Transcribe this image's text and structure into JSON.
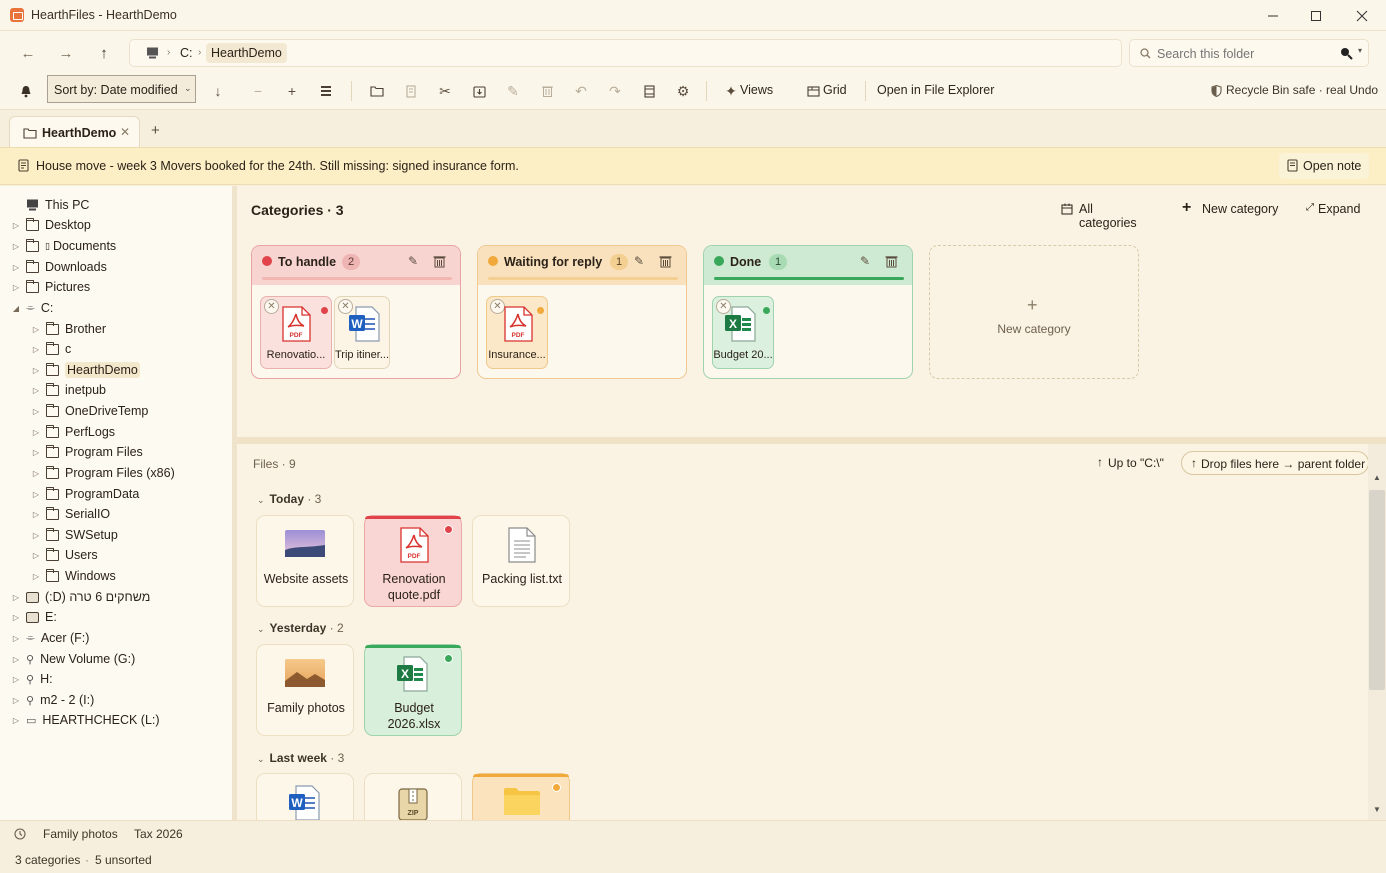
{
  "window": {
    "title": "HearthFiles - HearthDemo"
  },
  "address": {
    "segments": [
      "C:",
      "HearthDemo"
    ]
  },
  "search": {
    "placeholder": "Search this folder"
  },
  "toolbar": {
    "sort_label": "Sort by: Date modified",
    "views_label": "Views",
    "grid_label": "Grid",
    "open_explorer_label": "Open in File Explorer",
    "safety_label": "Recycle Bin safe · real Undo"
  },
  "tabs": [
    {
      "label": "HearthDemo"
    }
  ],
  "note": {
    "text": "House move - week 3 Movers booked for the 24th. Still missing: signed insurance form.",
    "open_label": "Open note"
  },
  "sidebar": {
    "items": [
      {
        "label": "This PC"
      },
      {
        "label": "Desktop"
      },
      {
        "label": "Documents"
      },
      {
        "label": "Downloads"
      },
      {
        "label": "Pictures"
      },
      {
        "label": "C:"
      },
      {
        "label": "Brother"
      },
      {
        "label": "c"
      },
      {
        "label": "HearthDemo"
      },
      {
        "label": "inetpub"
      },
      {
        "label": "OneDriveTemp"
      },
      {
        "label": "PerfLogs"
      },
      {
        "label": "Program Files"
      },
      {
        "label": "Program Files (x86)"
      },
      {
        "label": "ProgramData"
      },
      {
        "label": "SerialIO"
      },
      {
        "label": "SWSetup"
      },
      {
        "label": "Users"
      },
      {
        "label": "Windows"
      },
      {
        "label": "(:D) משחקים 6 טרה"
      },
      {
        "label": "E:"
      },
      {
        "label": "Acer (F:)"
      },
      {
        "label": "New Volume (G:)"
      },
      {
        "label": "H:"
      },
      {
        "label": "m2 - 2 (I:)"
      },
      {
        "label": "HEARTHCHECK (L:)"
      }
    ]
  },
  "categories": {
    "title": "Categories · 3",
    "all_label": "All categories",
    "new_label": "New category",
    "expand_label": "Expand",
    "cards": [
      {
        "name": "To handle",
        "count": "2",
        "color": "#e0434a",
        "items": [
          "Renovatio...",
          "Trip itiner..."
        ]
      },
      {
        "name": "Waiting for reply",
        "count": "1",
        "color": "#f0a93a",
        "items": [
          "Insurance..."
        ]
      },
      {
        "name": "Done",
        "count": "1",
        "color": "#3aa85a",
        "items": [
          "Budget 20..."
        ]
      }
    ],
    "new_card_label": "New category"
  },
  "files": {
    "count_label": "Files · 9",
    "up_label": "Up to \"C:\\\"",
    "drop_label": "Drop files here → parent folder",
    "groups": [
      {
        "name": "Today",
        "count": "· 3",
        "items": [
          {
            "name": "Website assets",
            "icon": "folder-image-icon"
          },
          {
            "name": "Renovation quote.pdf",
            "icon": "pdf-icon"
          },
          {
            "name": "Packing list.txt",
            "icon": "text-file-icon"
          }
        ]
      },
      {
        "name": "Yesterday",
        "count": "· 2",
        "items": [
          {
            "name": "Family photos",
            "icon": "folder-image-icon"
          },
          {
            "name": "Budget 2026.xlsx",
            "icon": "excel-icon"
          }
        ]
      },
      {
        "name": "Last week",
        "count": "· 3",
        "items": [
          {
            "name": "",
            "icon": "word-icon"
          },
          {
            "name": "",
            "icon": "zip-icon"
          },
          {
            "name": "",
            "icon": "folder-icon"
          }
        ]
      }
    ]
  },
  "recent": {
    "items": [
      "Family photos",
      "Tax 2026"
    ]
  },
  "status": {
    "categories": "3 categories",
    "unsorted": "5 unsorted"
  }
}
